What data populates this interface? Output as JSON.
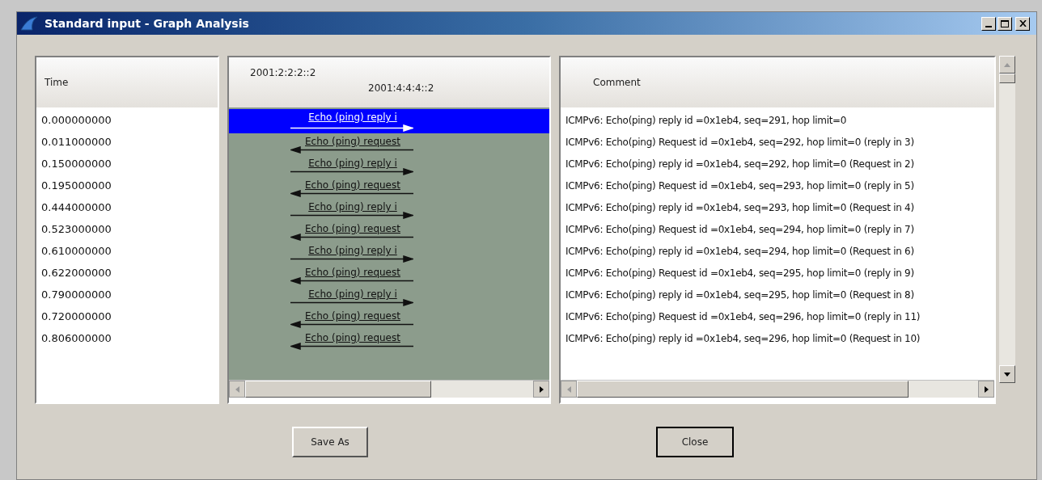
{
  "window": {
    "title": "Standard input - Graph Analysis"
  },
  "time_column": {
    "header": "Time"
  },
  "graph": {
    "hosts": [
      "2001:2:2:2::2",
      "2001:4:4:4::2"
    ]
  },
  "comment_column": {
    "header": "Comment"
  },
  "rows": [
    {
      "time": "0.000000000",
      "label": "Echo (ping) reply i",
      "kind": "reply",
      "selected": true,
      "comment": "ICMPv6: Echo(ping) reply id =0x1eb4, seq=291, hop limit=0"
    },
    {
      "time": "0.011000000",
      "label": "Echo (ping) request",
      "kind": "request",
      "selected": false,
      "comment": "ICMPv6: Echo(ping) Request id =0x1eb4, seq=292, hop limit=0 (reply in 3)"
    },
    {
      "time": "0.150000000",
      "label": "Echo (ping) reply i",
      "kind": "reply",
      "selected": false,
      "comment": "ICMPv6: Echo(ping) reply id =0x1eb4, seq=292, hop limit=0 (Request in 2)"
    },
    {
      "time": "0.195000000",
      "label": "Echo (ping) request",
      "kind": "request",
      "selected": false,
      "comment": "ICMPv6: Echo(ping) Request id =0x1eb4, seq=293, hop limit=0 (reply in 5)"
    },
    {
      "time": "0.444000000",
      "label": "Echo (ping) reply i",
      "kind": "reply",
      "selected": false,
      "comment": "ICMPv6: Echo(ping) reply id =0x1eb4, seq=293, hop limit=0 (Request in 4)"
    },
    {
      "time": "0.523000000",
      "label": "Echo (ping) request",
      "kind": "request",
      "selected": false,
      "comment": "ICMPv6: Echo(ping) Request id =0x1eb4, seq=294, hop limit=0 (reply in 7)"
    },
    {
      "time": "0.610000000",
      "label": "Echo (ping) reply i",
      "kind": "reply",
      "selected": false,
      "comment": "ICMPv6: Echo(ping) reply id =0x1eb4, seq=294, hop limit=0 (Request in 6)"
    },
    {
      "time": "0.622000000",
      "label": "Echo (ping) request",
      "kind": "request",
      "selected": false,
      "comment": "ICMPv6: Echo(ping) Request id =0x1eb4, seq=295, hop limit=0 (reply in 9)"
    },
    {
      "time": "0.790000000",
      "label": "Echo (ping) reply i",
      "kind": "reply",
      "selected": false,
      "comment": "ICMPv6: Echo(ping) reply id =0x1eb4, seq=295, hop limit=0 (Request in 8)"
    },
    {
      "time": "0.720000000",
      "label": "Echo (ping) request",
      "kind": "request",
      "selected": false,
      "comment": "ICMPv6: Echo(ping) Request id =0x1eb4, seq=296, hop limit=0 (reply in 11)"
    },
    {
      "time": "0.806000000",
      "label": "Echo (ping) request",
      "kind": "request",
      "selected": false,
      "comment": "ICMPv6: Echo(ping) reply id =0x1eb4, seq=296, hop limit=0 (Request in 10)"
    }
  ],
  "buttons": [
    {
      "label": "Save As"
    },
    {
      "label": "Close"
    }
  ]
}
